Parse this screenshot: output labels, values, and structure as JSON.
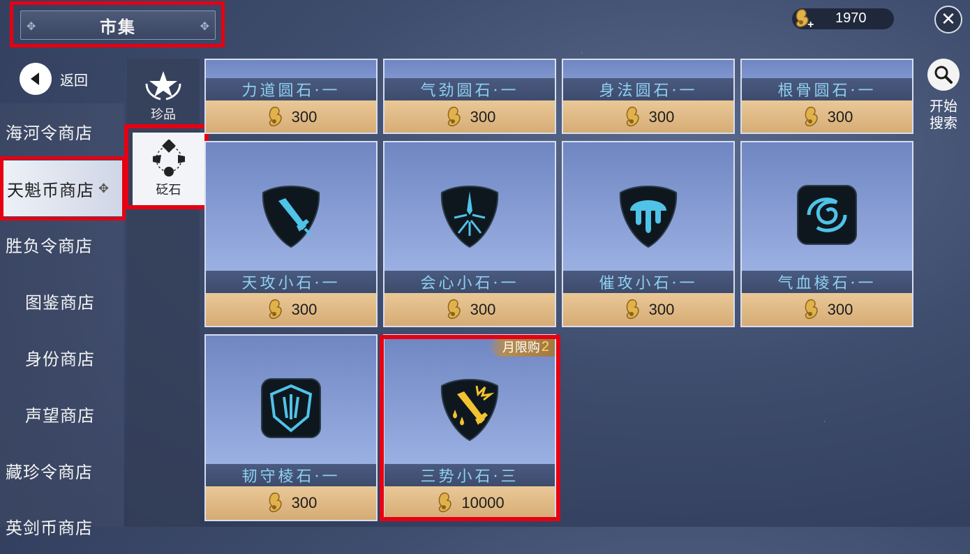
{
  "header": {
    "title": "市集",
    "currency_value": "1970",
    "coin_icon": "coin-plus-icon",
    "close_icon": "close-icon"
  },
  "back": {
    "label": "返回"
  },
  "sidebar": {
    "items": [
      {
        "label": "海河令商店"
      },
      {
        "label": "天魁币商店",
        "active": true
      },
      {
        "label": "胜负令商店"
      },
      {
        "label": "图鉴商店"
      },
      {
        "label": "身份商店"
      },
      {
        "label": "声望商店"
      },
      {
        "label": "藏珍令商店"
      },
      {
        "label": "英剑币商店"
      }
    ]
  },
  "categories": [
    {
      "label": "珍品",
      "icon": "star-laurel-icon"
    },
    {
      "label": "砭石",
      "icon": "stone-diamond-icon",
      "active": true
    }
  ],
  "items": [
    {
      "name": "力道圆石·一",
      "price": "300"
    },
    {
      "name": "气劲圆石·一",
      "price": "300"
    },
    {
      "name": "身法圆石·一",
      "price": "300"
    },
    {
      "name": "根骨圆石·一",
      "price": "300"
    },
    {
      "name": "天攻小石·一",
      "price": "300",
      "icon": "sword-stone-icon"
    },
    {
      "name": "会心小石·一",
      "price": "300",
      "icon": "crit-burst-stone-icon"
    },
    {
      "name": "催攻小石·一",
      "price": "300",
      "icon": "drip-stone-icon"
    },
    {
      "name": "气血棱石·一",
      "price": "300",
      "icon": "swirl-stone-icon"
    },
    {
      "name": "韧守棱石·一",
      "price": "300",
      "icon": "shield-claw-stone-icon"
    },
    {
      "name": "三势小石·三",
      "price": "10000",
      "icon": "golden-sword-stone-icon",
      "limit_label": "月限购",
      "limit_count": "2"
    }
  ],
  "search": {
    "label": "开始搜索"
  },
  "colors": {
    "highlight": "#e60012",
    "price_bg": "#e0bb86",
    "name_text": "#8fd0f0"
  }
}
